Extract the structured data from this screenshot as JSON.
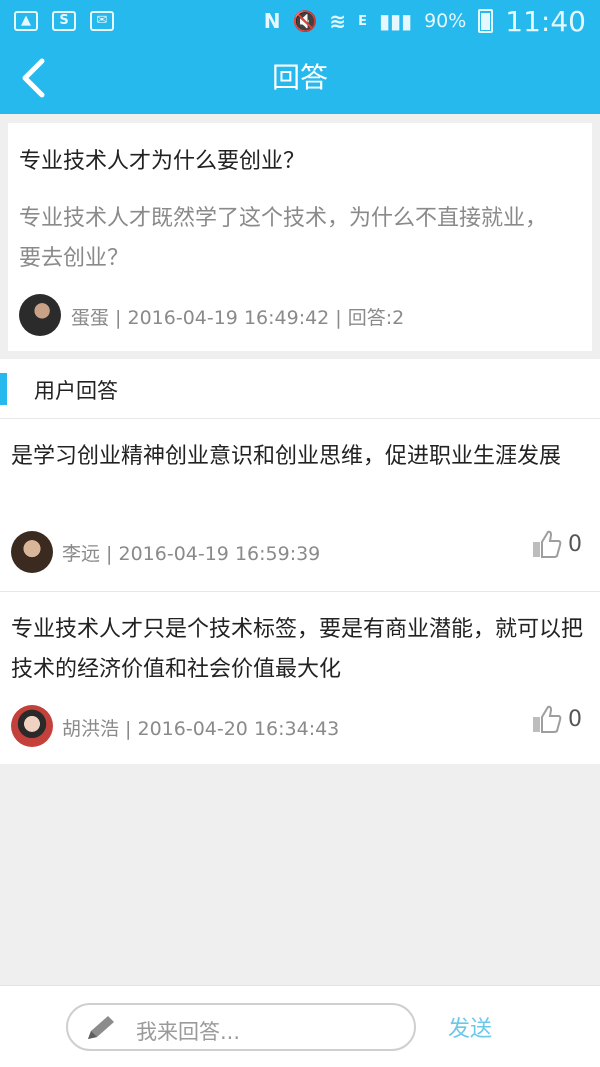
{
  "status_bar": {
    "left_icons": [
      "gallery-icon",
      "s-icon",
      "mail-icon"
    ],
    "right_symbols": [
      "N",
      "E"
    ],
    "battery": "90%",
    "time": "11:40"
  },
  "nav": {
    "title": "回答"
  },
  "question": {
    "title": "专业技术人才为什么要创业？",
    "description": "专业技术人才既然学了这个技术，为什么不直接就业，要去创业？",
    "meta": "蛋蛋 | 2016-04-19 16:49:42 | 回答:2"
  },
  "answers_section": {
    "title": "用户回答",
    "items": [
      {
        "text": "是学习创业精神创业意识和创业思维，促进职业生涯发展",
        "meta": "李远 | 2016-04-19 16:59:39",
        "likes": "0"
      },
      {
        "text": "专业技术人才只是个技术标签，要是有商业潜能，就可以把技术的经济价值和社会价值最大化",
        "meta": "胡洪浩 | 2016-04-20 16:34:43",
        "likes": "0"
      }
    ]
  },
  "input_bar": {
    "placeholder": "我来回答...",
    "send_label": "发送"
  },
  "colors": {
    "brand": "#25b9ee",
    "send": "#6cc8e8",
    "muted_text": "#8a8a8a"
  }
}
